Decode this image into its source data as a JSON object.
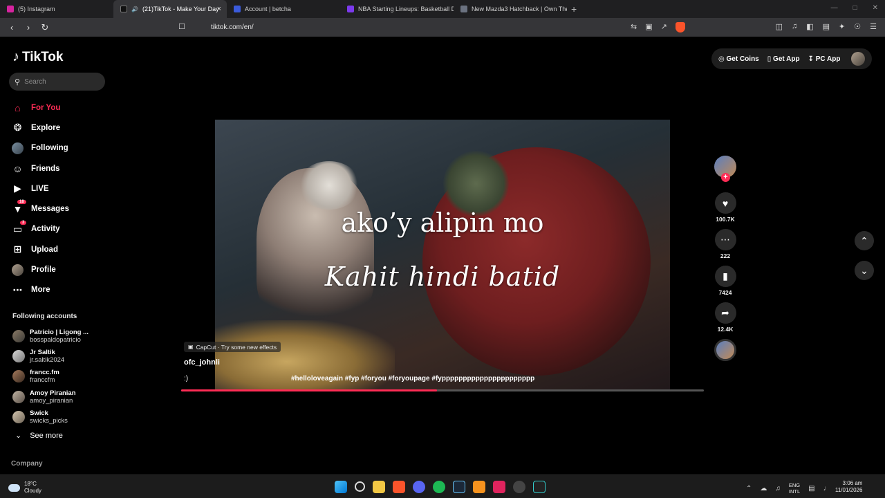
{
  "browser": {
    "tabs": [
      {
        "label": "(5) Instagram",
        "color": "#d6249f"
      },
      {
        "label": "(21)TikTok - Make Your Day",
        "color": "#000000",
        "active": true
      },
      {
        "label": "Account | betcha",
        "color": "#3b5bdb"
      },
      {
        "label": "NBA Starting Lineups: Basketball Dai",
        "color": "#7c3aed"
      },
      {
        "label": "New Mazda3 Hatchback | Own The N",
        "color": "#6b7280"
      }
    ],
    "close_glyph": "×",
    "new_tab_glyph": "+",
    "url": "tiktok.com/en/"
  },
  "sidebar": {
    "logo": "TikTok",
    "search_placeholder": "Search",
    "menu": [
      {
        "label": "For You",
        "icon": "home-icon",
        "active": true
      },
      {
        "label": "Explore",
        "icon": "compass-icon"
      },
      {
        "label": "Following",
        "icon": "following-avatar-icon"
      },
      {
        "label": "Friends",
        "icon": "friends-icon"
      },
      {
        "label": "LIVE",
        "icon": "live-icon"
      },
      {
        "label": "Messages",
        "icon": "messages-icon",
        "badge": "18"
      },
      {
        "label": "Activity",
        "icon": "activity-icon",
        "badge": "3"
      },
      {
        "label": "Upload",
        "icon": "upload-icon"
      },
      {
        "label": "Profile",
        "icon": "profile-avatar-icon"
      },
      {
        "label": "More",
        "icon": "more-icon"
      }
    ],
    "following_title": "Following accounts",
    "following": [
      {
        "name": "Patricio | Ligong ...",
        "handle": "bosspaldopatricio"
      },
      {
        "name": "Jr Saltik",
        "handle": "jr.saltik2024"
      },
      {
        "name": "francc.fm",
        "handle": "franccfm"
      },
      {
        "name": "Amoy Piranian",
        "handle": "amoy_piranian"
      },
      {
        "name": "Swick",
        "handle": "swicks_picks"
      }
    ],
    "see_more": "See more",
    "company": "Company"
  },
  "header": {
    "get_coins": "Get Coins",
    "get_app": "Get App",
    "pc_app": "PC App"
  },
  "video": {
    "lyric_line1": "ako’y alipin mo",
    "lyric_line2": "Kahit hindi batid",
    "capcut": "CapCut · Try some new effects",
    "author": "ofc_johnli",
    "description": ":)",
    "hashtags": "#helloloveagain #fyp #foryou #foryoupage #fypppppppppppppppppppppp",
    "progress_percent": 49
  },
  "actions": {
    "likes": "100.7K",
    "comments": "222",
    "saves": "7424",
    "shares": "12.4K"
  },
  "taskbar": {
    "temp": "18°C",
    "condition": "Cloudy",
    "lang1": "ENG",
    "lang2": "INTL",
    "time": "3:06 am",
    "date": "11/01/2026"
  },
  "colors": {
    "accent": "#fe2c55"
  }
}
